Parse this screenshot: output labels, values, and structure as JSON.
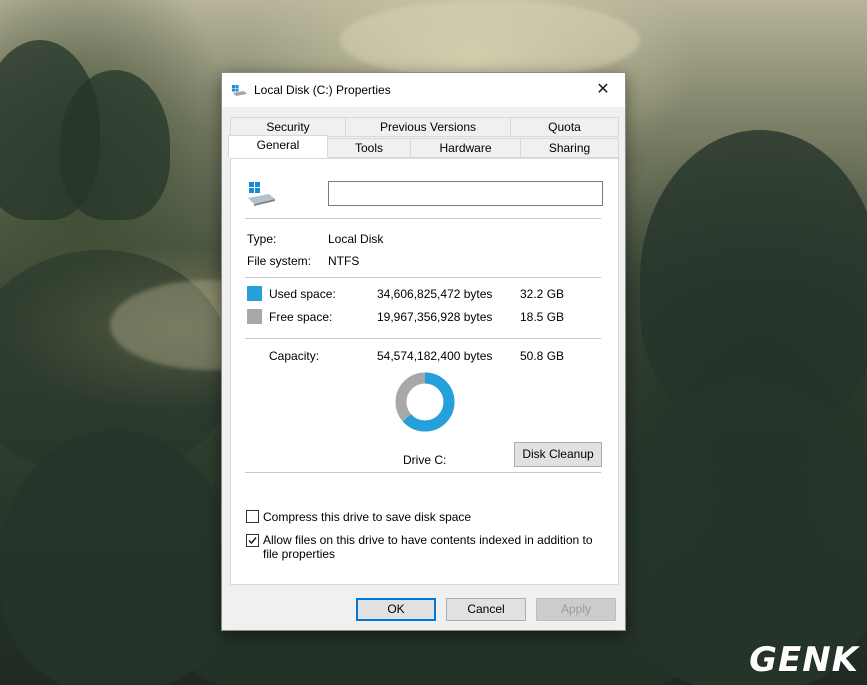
{
  "window": {
    "title": "Local Disk (C:) Properties",
    "close_glyph": "✕",
    "title_icon": "drive-icon"
  },
  "tabs_back_row": [
    {
      "label": "Security"
    },
    {
      "label": "Previous Versions"
    },
    {
      "label": "Quota"
    }
  ],
  "tabs_front_row": [
    {
      "label": "General",
      "active": true
    },
    {
      "label": "Tools"
    },
    {
      "label": "Hardware"
    },
    {
      "label": "Sharing"
    }
  ],
  "general": {
    "drive_icon": "windows-drive-icon",
    "volume_label_value": "",
    "type_label": "Type:",
    "type_value": "Local Disk",
    "fs_label": "File system:",
    "fs_value": "NTFS",
    "used": {
      "label": "Used space:",
      "bytes": "34,606,825,472 bytes",
      "size": "32.2 GB",
      "color": "#26a0da"
    },
    "free": {
      "label": "Free space:",
      "bytes": "19,967,356,928 bytes",
      "size": "18.5 GB",
      "color": "#a8a8a8"
    },
    "capacity": {
      "label": "Capacity:",
      "bytes": "54,574,182,400 bytes",
      "size": "50.8 GB"
    },
    "used_fraction": 0.634,
    "drive_caption": "Drive C:",
    "cleanup_label": "Disk Cleanup",
    "compress_label": "Compress this drive to save disk space",
    "compress_checked": false,
    "index_label_line1": "Allow files on this drive to have contents indexed in addition to",
    "index_label_line2": "file properties",
    "index_checked": true
  },
  "buttons": {
    "ok": "OK",
    "cancel": "Cancel",
    "apply": "Apply"
  },
  "watermark": "GENK"
}
